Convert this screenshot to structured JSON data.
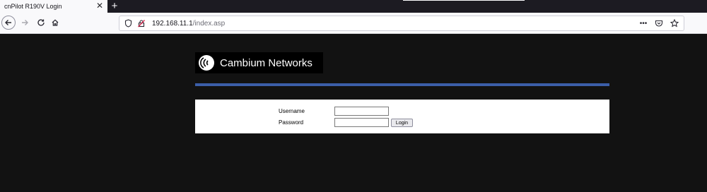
{
  "browser": {
    "tab": {
      "title": "cnPilot R190V Login",
      "close_glyph": "✕"
    },
    "new_tab_glyph": "+",
    "url": {
      "host": "192.168.11.1",
      "path": "/index.asp"
    },
    "page_actions_glyph": "•••"
  },
  "page": {
    "logo_text": "Cambium Networks",
    "login": {
      "username_label": "Username",
      "password_label": "Password",
      "username_value": "",
      "password_value": "",
      "submit_label": "Login"
    }
  },
  "colors": {
    "page_background": "#121212",
    "accent_rule": "#3b5ea8",
    "tabstrip": "#1c1b22"
  },
  "icons": [
    "back-arrow-icon",
    "forward-arrow-icon",
    "reload-icon",
    "home-icon",
    "shield-icon",
    "insecure-lock-icon",
    "pocket-icon",
    "bookmark-star-icon",
    "cambium-logo-icon"
  ]
}
